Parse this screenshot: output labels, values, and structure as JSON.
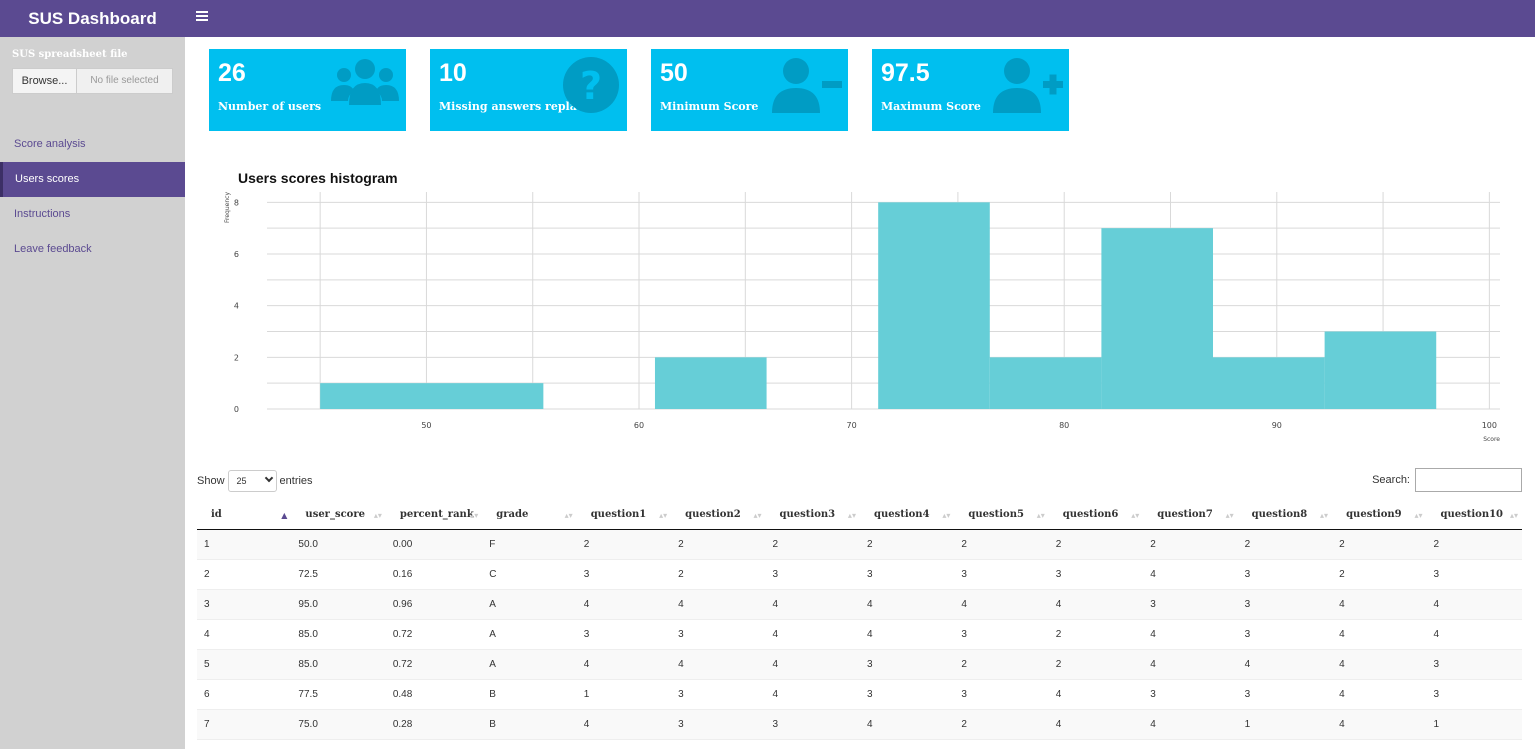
{
  "app": {
    "title": "SUS Dashboard",
    "menu_icon": "hamburger-icon"
  },
  "sidebar": {
    "file_label": "SUS spreadsheet file",
    "browse_label": "Browse...",
    "no_file_label": "No file selected",
    "items": [
      {
        "label": "Score analysis",
        "active": false
      },
      {
        "label": "Users scores",
        "active": true
      },
      {
        "label": "Instructions",
        "active": false
      },
      {
        "label": "Leave feedback",
        "active": false
      }
    ]
  },
  "value_boxes": [
    {
      "value": "26",
      "label": "Number of users",
      "icon": "users-icon"
    },
    {
      "value": "10",
      "label": "Missing answers replaced",
      "icon": "question-circle-icon"
    },
    {
      "value": "50",
      "label": "Minimum Score",
      "icon": "user-minus-icon"
    },
    {
      "value": "97.5",
      "label": "Maximum Score",
      "icon": "user-plus-icon"
    }
  ],
  "colors": {
    "header": "#5b4a91",
    "box": "#00bfef",
    "bar": "#66ced7"
  },
  "chart_data": {
    "type": "bar",
    "title": "Users scores histogram",
    "xlabel": "Score",
    "ylabel": "Frequency",
    "bins": [
      {
        "x0": 45,
        "x1": 55.5,
        "count": 1
      },
      {
        "x0": 60.75,
        "x1": 66,
        "count": 2
      },
      {
        "x0": 71.25,
        "x1": 76.5,
        "count": 8
      },
      {
        "x0": 76.5,
        "x1": 81.75,
        "count": 2
      },
      {
        "x0": 81.75,
        "x1": 87,
        "count": 7
      },
      {
        "x0": 87,
        "x1": 92.25,
        "count": 2
      },
      {
        "x0": 92.25,
        "x1": 97.5,
        "count": 3
      }
    ],
    "x_ticks": [
      "50",
      "60",
      "70",
      "80",
      "90",
      "100"
    ],
    "y_ticks": [
      "0",
      "2",
      "4",
      "6",
      "8"
    ],
    "xlim": [
      42.5,
      100.5
    ],
    "ylim": [
      0,
      8.4
    ],
    "grid": true
  },
  "table": {
    "show_label": "Show",
    "entries_label": "entries",
    "page_size": "25",
    "search_label": "Search:",
    "columns": [
      "id",
      "user_score",
      "percent_rank",
      "grade",
      "question1",
      "question2",
      "question3",
      "question4",
      "question5",
      "question6",
      "question7",
      "question8",
      "question9",
      "question10"
    ],
    "rows": [
      [
        "1",
        "50.0",
        "0.00",
        "F",
        "2",
        "2",
        "2",
        "2",
        "2",
        "2",
        "2",
        "2",
        "2",
        "2"
      ],
      [
        "2",
        "72.5",
        "0.16",
        "C",
        "3",
        "2",
        "3",
        "3",
        "3",
        "3",
        "4",
        "3",
        "2",
        "3"
      ],
      [
        "3",
        "95.0",
        "0.96",
        "A",
        "4",
        "4",
        "4",
        "4",
        "4",
        "4",
        "3",
        "3",
        "4",
        "4"
      ],
      [
        "4",
        "85.0",
        "0.72",
        "A",
        "3",
        "3",
        "4",
        "4",
        "3",
        "2",
        "4",
        "3",
        "4",
        "4"
      ],
      [
        "5",
        "85.0",
        "0.72",
        "A",
        "4",
        "4",
        "4",
        "3",
        "2",
        "2",
        "4",
        "4",
        "4",
        "3"
      ],
      [
        "6",
        "77.5",
        "0.48",
        "B",
        "1",
        "3",
        "4",
        "3",
        "3",
        "4",
        "3",
        "3",
        "4",
        "3"
      ],
      [
        "7",
        "75.0",
        "0.28",
        "B",
        "4",
        "3",
        "3",
        "4",
        "2",
        "4",
        "4",
        "1",
        "4",
        "1"
      ]
    ]
  }
}
